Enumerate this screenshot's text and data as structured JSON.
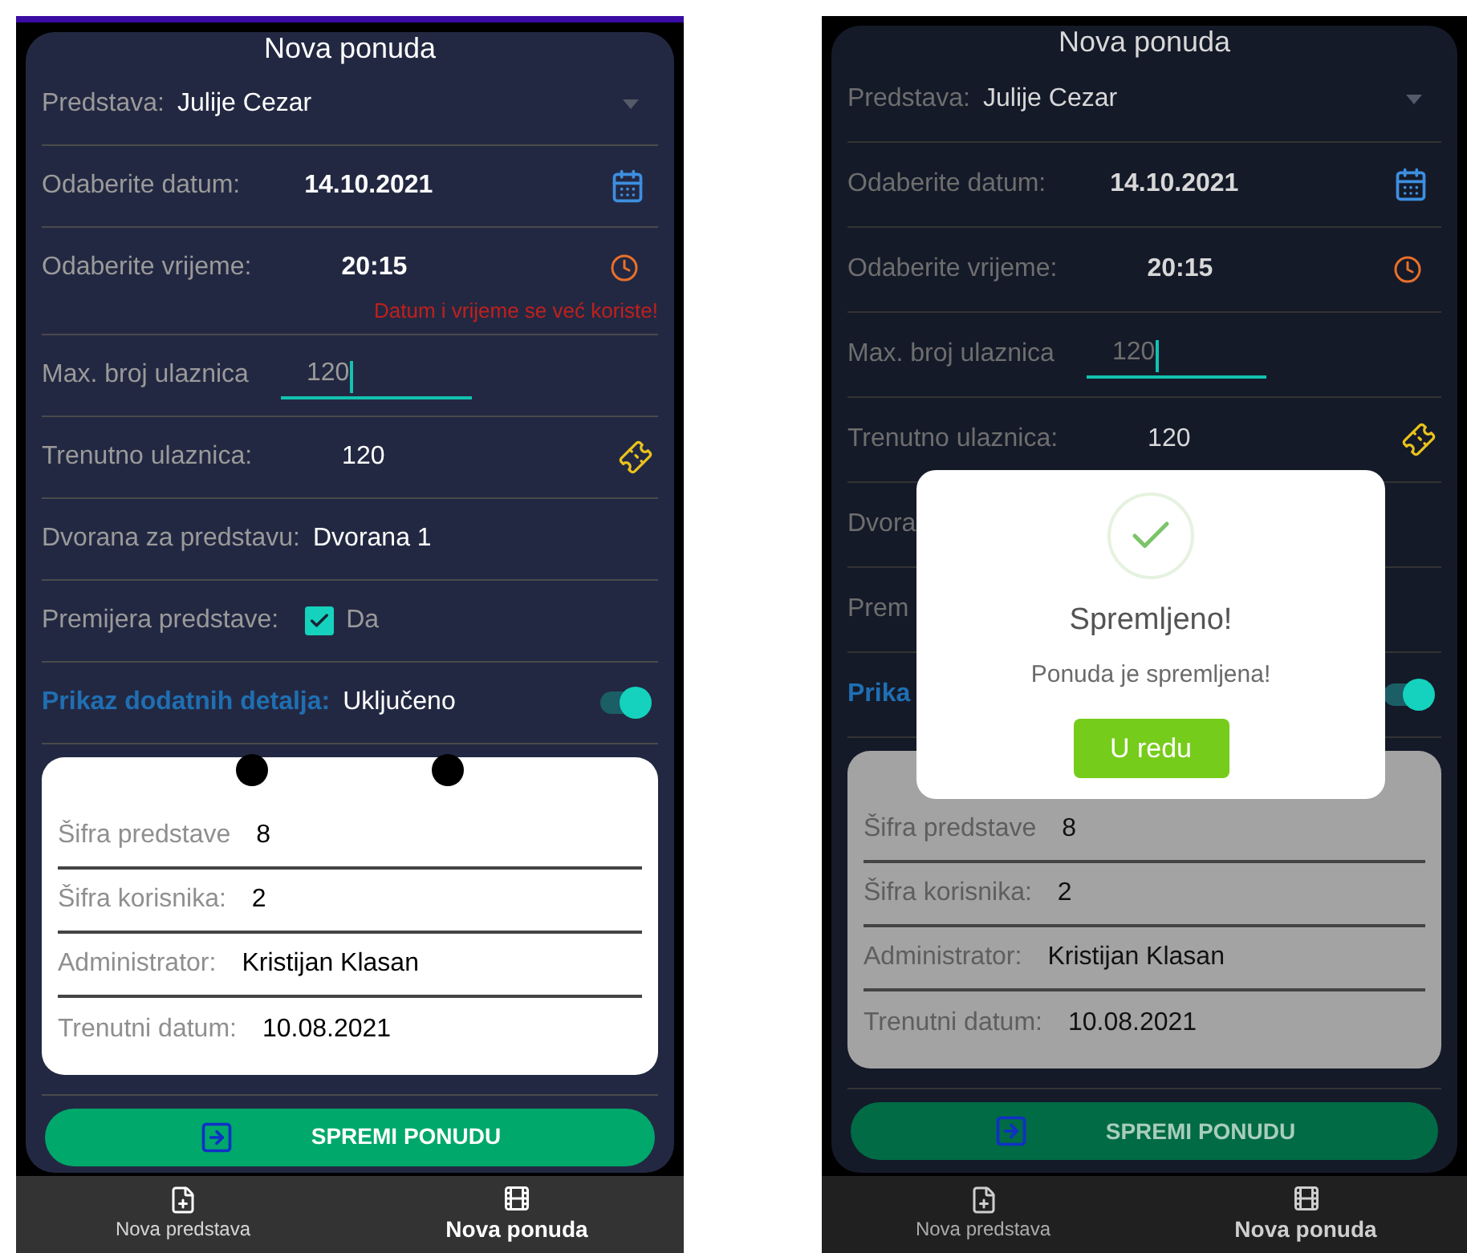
{
  "screens": [
    {
      "dimmed": false,
      "top_bar": true,
      "title": "Nova ponuda",
      "rows": [
        {
          "kind": "select",
          "label": "Predstava:",
          "value": "Julije Cezar"
        },
        {
          "kind": "date",
          "label": "Odaberite datum:",
          "value": "14.10.2021"
        },
        {
          "kind": "time",
          "label": "Odaberite vrijeme:",
          "value": "20:15",
          "error": "Datum i vrijeme se već koriste!"
        },
        {
          "kind": "input",
          "label": "Max. broj ulaznica",
          "value": "120"
        },
        {
          "kind": "count",
          "label": "Trenutno ulaznica:",
          "value": "120"
        },
        {
          "kind": "text",
          "label": "Dvorana za predstavu:",
          "value": "Dvorana 1"
        },
        {
          "kind": "checkbox",
          "label": "Premijera predstave:",
          "checked": true,
          "value": "Da"
        },
        {
          "kind": "toggle",
          "label": "Prikaz dodatnih detalja:",
          "value": "Uključeno",
          "on": true
        }
      ],
      "details": {
        "holes": true,
        "rows": [
          {
            "label": "Šifra predstave",
            "value": "8"
          },
          {
            "label": "Šifra korisnika:",
            "value": "2"
          },
          {
            "label": "Administrator:",
            "value": "Kristijan Klasan"
          },
          {
            "label": "Trenutni datum:",
            "value": "10.08.2021"
          }
        ]
      },
      "save_button": "SPREMI PONUDU",
      "nav": [
        {
          "label": "Nova predstava",
          "selected": false
        },
        {
          "label": "Nova ponuda",
          "selected": true
        }
      ]
    },
    {
      "dimmed": true,
      "top_bar": false,
      "title": "Nova ponuda",
      "rows": [
        {
          "kind": "select",
          "label": "Predstava:",
          "value": "Julije Cezar"
        },
        {
          "kind": "date",
          "label": "Odaberite datum:",
          "value": "14.10.2021"
        },
        {
          "kind": "time",
          "label": "Odaberite vrijeme:",
          "value": "20:15"
        },
        {
          "kind": "input",
          "label": "Max. broj ulaznica",
          "value": "120"
        },
        {
          "kind": "count",
          "label": "Trenutno ulaznica:",
          "value": "120"
        },
        {
          "kind": "text",
          "label": "Dvora"
        },
        {
          "kind": "text",
          "label": "Prem"
        },
        {
          "kind": "toggle",
          "label": "Prika",
          "on": true
        }
      ],
      "details": {
        "rows": [
          {
            "label": "Šifra predstave",
            "value": "8"
          },
          {
            "label": "Šifra korisnika:",
            "value": "2"
          },
          {
            "label": "Administrator:",
            "value": "Kristijan Klasan"
          },
          {
            "label": "Trenutni datum:",
            "value": "10.08.2021"
          }
        ]
      },
      "dialog": {
        "title": "Spremljeno!",
        "message": "Ponuda je spremljena!",
        "button": "U redu"
      },
      "save_button": "SPREMI PONUDU",
      "nav": [
        {
          "label": "Nova predstava",
          "selected": false
        },
        {
          "label": "Nova ponuda",
          "selected": true
        }
      ]
    }
  ]
}
